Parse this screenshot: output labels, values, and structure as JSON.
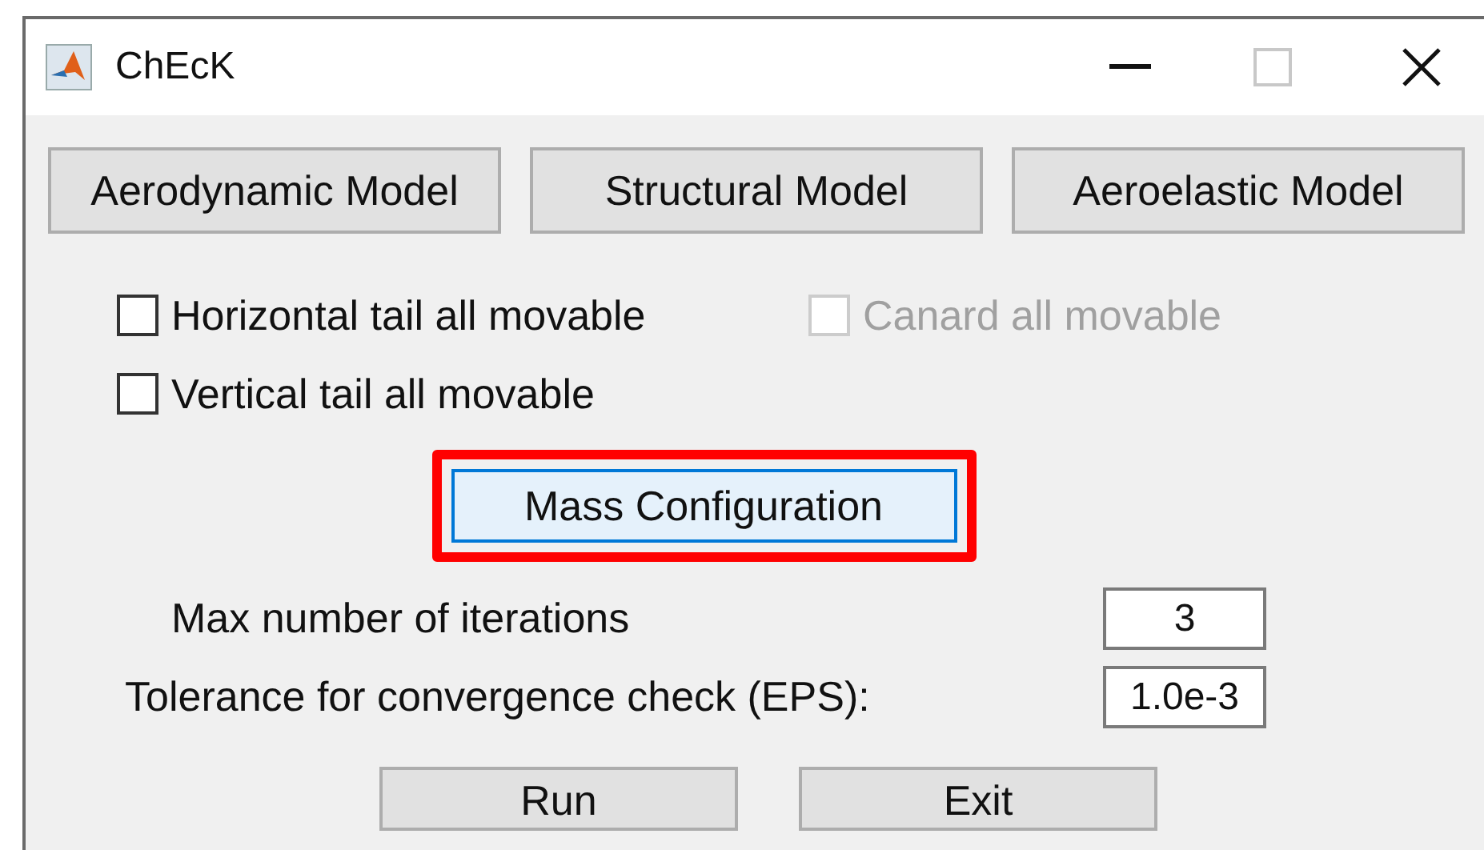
{
  "window": {
    "title": "ChEcK"
  },
  "model_buttons": [
    "Aerodynamic Model",
    "Structural Model",
    "Aeroelastic Model"
  ],
  "checkboxes": [
    {
      "label": "Horizontal tail all movable",
      "checked": false,
      "disabled": false
    },
    {
      "label": "Canard all movable",
      "checked": false,
      "disabled": true
    },
    {
      "label": "Vertical tail all movable",
      "checked": false,
      "disabled": false
    }
  ],
  "mass_button": {
    "label": "Mass Configuration",
    "highlighted": true
  },
  "fields": [
    {
      "label": "Max number of iterations",
      "value": "3"
    },
    {
      "label": "Tolerance for convergence check (EPS):",
      "value": "1.0e-3"
    }
  ],
  "action_buttons": [
    "Run",
    "Exit"
  ]
}
